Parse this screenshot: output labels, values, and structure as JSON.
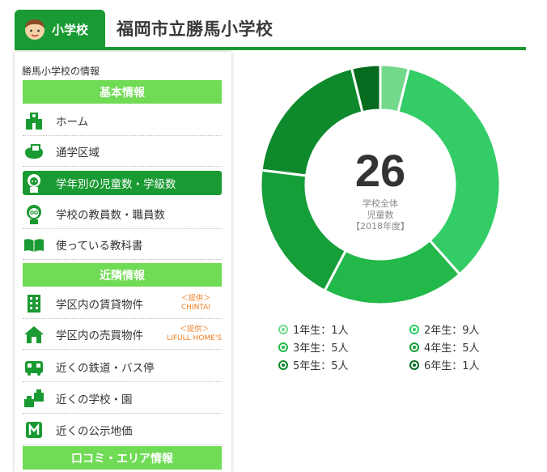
{
  "header": {
    "badge_label": "小学校",
    "title": "福岡市立勝馬小学校"
  },
  "sidebar": {
    "caption": "勝馬小学校の情報",
    "sections": [
      {
        "title": "基本情報"
      },
      {
        "title": "近隣情報"
      },
      {
        "title": "口コミ・エリア情報"
      }
    ],
    "items": [
      {
        "label": "ホーム",
        "icon": "school-building-icon"
      },
      {
        "label": "通学区域",
        "icon": "area-map-icon"
      },
      {
        "label": "学年別の児童数・学級数",
        "icon": "student-icon",
        "active": true
      },
      {
        "label": "学校の教員数・職員数",
        "icon": "teacher-icon"
      },
      {
        "label": "使っている教科書",
        "icon": "book-icon"
      },
      {
        "label": "学区内の賃貸物件",
        "icon": "apartment-icon",
        "provider_top": "＜提供＞",
        "provider_name": "CHINTAI"
      },
      {
        "label": "学区内の売買物件",
        "icon": "house-icon",
        "provider_top": "＜提供＞",
        "provider_name": "LIFULL HOME'S"
      },
      {
        "label": "近くの鉄道・バス停",
        "icon": "train-icon"
      },
      {
        "label": "近くの学校・園",
        "icon": "schools-icon"
      },
      {
        "label": "近くの公示地価",
        "icon": "land-price-icon"
      }
    ]
  },
  "center": {
    "total": "26",
    "label_line1": "学校全体",
    "label_line2": "児童数",
    "label_line3": "【2018年度】"
  },
  "chart_data": {
    "type": "pie",
    "donut": true,
    "title": "",
    "categories": [
      "1年生",
      "2年生",
      "3年生",
      "4年生",
      "5年生",
      "6年生"
    ],
    "values": [
      1,
      9,
      5,
      5,
      5,
      1
    ],
    "value_labels": [
      "1年生：1人",
      "2年生：9人",
      "3年生：5人",
      "4年生：5人",
      "5年生：5人",
      "6年生：1人"
    ],
    "colors": [
      "#72d98a",
      "#33cc66",
      "#22b84a",
      "#169e38",
      "#0e8a2c",
      "#066b1e"
    ]
  },
  "theme": {
    "accent": "#1a9a32",
    "section_bar": "#70db55",
    "provider": "#f07d22"
  }
}
